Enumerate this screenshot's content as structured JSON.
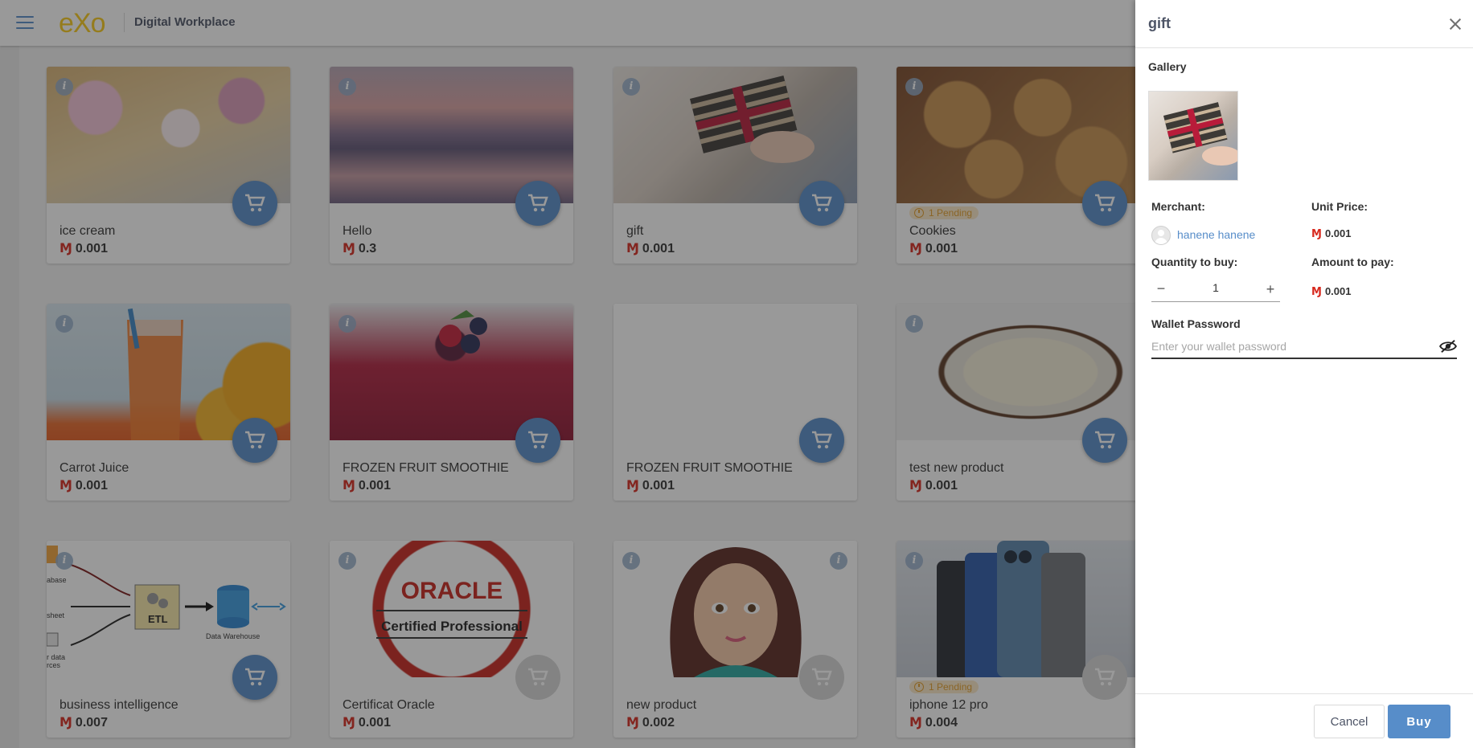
{
  "header": {
    "app_title": "Digital Workplace",
    "logo_text": "eXo"
  },
  "currency_symbol": "Ɱ",
  "products": [
    {
      "name": "ice cream",
      "price": "0.001"
    },
    {
      "name": "Hello",
      "price": "0.3"
    },
    {
      "name": "gift",
      "price": "0.001"
    },
    {
      "name": "Cookies",
      "price": "0.001",
      "pending": "1 Pending"
    },
    {
      "name": "Carrot Juice",
      "price": "0.001"
    },
    {
      "name": "FROZEN FRUIT SMOOTHIE",
      "price": "0.001"
    },
    {
      "name": "FROZEN FRUIT SMOOTHIE",
      "price": "0.001"
    },
    {
      "name": "test new product",
      "price": "0.001"
    },
    {
      "name": "business intelligence",
      "price": "0.007"
    },
    {
      "name": "Certificat Oracle",
      "price": "0.001"
    },
    {
      "name": "new product",
      "price": "0.002"
    },
    {
      "name": "iphone 12 pro",
      "price": "0.004",
      "pending": "1 Pending"
    }
  ],
  "art_text": {
    "bi_etl": "ETL",
    "bi_warehouse": "Data Warehouse",
    "bi_database": "abase",
    "bi_sheet": "sheet",
    "bi_sources": "r data\nrces",
    "oracle_logo": "ORACLE",
    "oracle_cert": "Certified Professional"
  },
  "drawer": {
    "title": "gift",
    "gallery_label": "Gallery",
    "merchant_label": "Merchant:",
    "merchant_name": "hanene hanene",
    "unit_price_label": "Unit Price:",
    "unit_price": "0.001",
    "quantity_label": "Quantity to buy:",
    "quantity": "1",
    "amount_label": "Amount to pay:",
    "amount": "0.001",
    "wallet_password_label": "Wallet Password",
    "wallet_password_placeholder": "Enter your wallet password",
    "cancel_label": "Cancel",
    "buy_label": "Buy"
  },
  "colors": {
    "primary": "#578dc9",
    "currency": "#d7291e",
    "pending_bg": "#fbe9c8",
    "pending_text": "#e39e2a",
    "overlay": "rgba(33,33,33,0.46)"
  }
}
